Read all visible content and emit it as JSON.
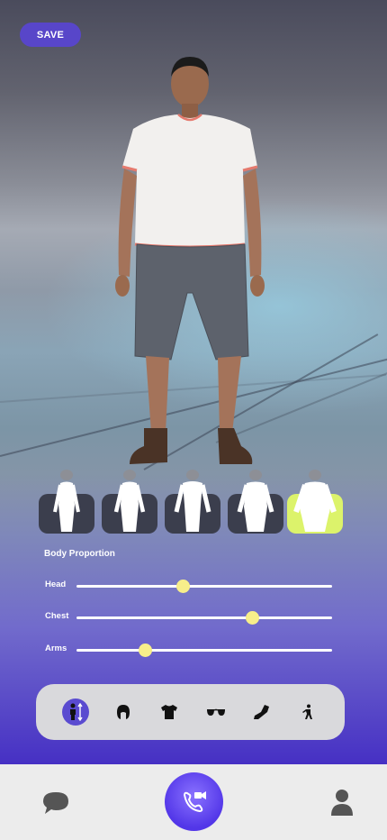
{
  "header": {
    "save_label": "SAVE"
  },
  "body_types": {
    "items": [
      {
        "name": "slim",
        "selected": false
      },
      {
        "name": "average",
        "selected": false
      },
      {
        "name": "athletic",
        "selected": false
      },
      {
        "name": "stocky",
        "selected": false
      },
      {
        "name": "heavy",
        "selected": true
      }
    ],
    "selected_color": "#dcf36b"
  },
  "body_proportion": {
    "title": "Body Proportion",
    "sliders": [
      {
        "label": "Head",
        "value": 0.42
      },
      {
        "label": "Chest",
        "value": 0.69
      },
      {
        "label": "Arms",
        "value": 0.27
      }
    ]
  },
  "toolbar": {
    "items": [
      {
        "icon": "body-adjust-icon",
        "active": true
      },
      {
        "icon": "hair-icon",
        "active": false
      },
      {
        "icon": "shirt-icon",
        "active": false
      },
      {
        "icon": "glasses-icon",
        "active": false
      },
      {
        "icon": "shoe-icon",
        "active": false
      },
      {
        "icon": "pose-icon",
        "active": false
      }
    ]
  },
  "bottom_nav": {
    "items": [
      "chat-icon",
      "video-call-icon",
      "profile-icon"
    ],
    "accent": "#5a4bd0"
  }
}
